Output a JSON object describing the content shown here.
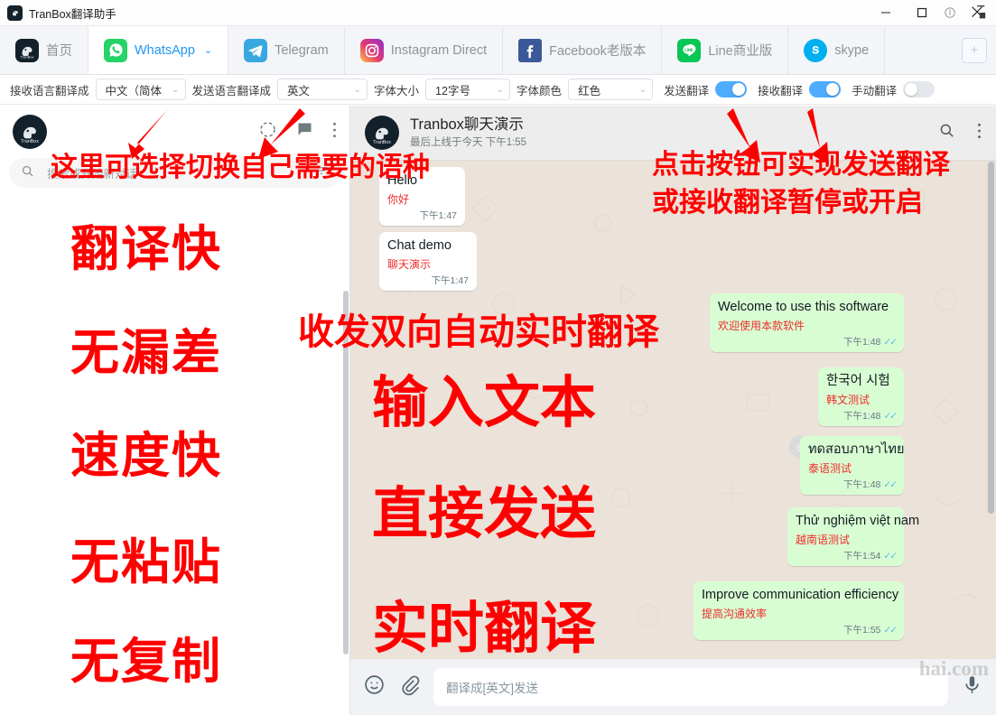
{
  "window": {
    "title": "TranBox翻译助手",
    "logo_icon": "tranbox-logo-icon",
    "minimize": "–",
    "maximize": "□",
    "info_icon": "info-icon",
    "close_icon": "close-icon"
  },
  "tabs": [
    {
      "label": "首页",
      "icon": "tranbox-home-icon",
      "active": false,
      "caret": ""
    },
    {
      "label": "WhatsApp",
      "icon": "whatsapp-icon",
      "active": true,
      "caret": "⌄"
    },
    {
      "label": "Telegram",
      "icon": "telegram-icon",
      "active": false,
      "caret": ""
    },
    {
      "label": "Instagram Direct",
      "icon": "instagram-icon",
      "active": false,
      "caret": ""
    },
    {
      "label": "Facebook老版本",
      "icon": "facebook-icon",
      "active": false,
      "caret": ""
    },
    {
      "label": "Line商业版",
      "icon": "line-icon",
      "active": false,
      "caret": ""
    },
    {
      "label": "skype",
      "icon": "skype-icon",
      "active": false,
      "caret": ""
    }
  ],
  "tab_add_label": "+",
  "toolbar": {
    "recv_lang_label": "接收语言翻译成",
    "recv_lang_value": "中文（简体",
    "send_lang_label": "发送语言翻译成",
    "send_lang_value": "英文",
    "font_size_label": "字体大小",
    "font_size_value": "12字号",
    "font_color_label": "字体颜色",
    "font_color_value": "红色",
    "send_translate_label": "发送翻译",
    "send_translate_on": true,
    "recv_translate_label": "接收翻译",
    "recv_translate_on": true,
    "manual_translate_label": "手动翻译",
    "manual_translate_on": false,
    "caret_icon": "chevron-down-icon"
  },
  "left_pane": {
    "avatar_name": "TranBox",
    "status_icon": "status-circle-icon",
    "new_chat_icon": "new-chat-icon",
    "menu_icon": "more-vertical-icon",
    "search_placeholder": "搜索或开始新对话",
    "search_icon": "search-icon",
    "filter_icon": "filter-icon"
  },
  "chat": {
    "contact_name": "Tranbox聊天演示",
    "contact_status": "最后上线于今天 下午1:55",
    "search_icon": "search-icon",
    "menu_icon": "more-vertical-icon",
    "messages": [
      {
        "text": "Hello",
        "translation": "你好",
        "time": "下午1:47",
        "side": "in",
        "ticks": false
      },
      {
        "text": "Chat demo",
        "translation": "聊天演示",
        "time": "下午1:47",
        "side": "in",
        "ticks": false
      },
      {
        "text": "Welcome to use this software",
        "translation": "欢迎使用本款软件",
        "time": "下午1:48",
        "side": "out",
        "ticks": true
      },
      {
        "text": "한국어 시험",
        "translation": "韩文测试",
        "time": "下午1:48",
        "side": "out",
        "ticks": true
      },
      {
        "text": "ทดสอบภาษาไทย",
        "translation": "泰语测试",
        "time": "下午1:48",
        "side": "out",
        "ticks": true
      },
      {
        "text": "Thử nghiệm việt nam",
        "translation": "越南语测试",
        "time": "下午1:54",
        "side": "out",
        "ticks": true
      },
      {
        "text": "Improve communication efficiency",
        "translation": "提高沟通效率",
        "time": "下午1:55",
        "side": "out",
        "ticks": true
      }
    ],
    "tick_glyph": "✓✓"
  },
  "composer": {
    "emoji_icon": "emoji-icon",
    "attach_icon": "paperclip-icon",
    "placeholder": "翻译成[英文]发送",
    "mic_icon": "microphone-icon"
  },
  "annotations": [
    {
      "id": "lang-switch-note",
      "text": "这里可选择切换自己需要的语种"
    },
    {
      "id": "toggle-note-line1",
      "text": "点击按钮可实现发送翻译"
    },
    {
      "id": "toggle-note-line2",
      "text": "或接收翻译暂停或开启"
    },
    {
      "id": "feature-1",
      "text": "翻译快"
    },
    {
      "id": "feature-2",
      "text": "无漏差"
    },
    {
      "id": "feature-3",
      "text": "速度快"
    },
    {
      "id": "feature-4",
      "text": "无粘贴"
    },
    {
      "id": "feature-5",
      "text": "无复制"
    },
    {
      "id": "center-note",
      "text": "收发双向自动实时翻译"
    },
    {
      "id": "center-1",
      "text": "输入文本"
    },
    {
      "id": "center-2",
      "text": "直接发送"
    },
    {
      "id": "center-3",
      "text": "实时翻译"
    }
  ],
  "watermark": "hai.com",
  "colors": {
    "accent": "#2196f3",
    "toggle_on": "#4facfe",
    "annotation_red": "#ff0000",
    "bubble_out": "#d9fdd3",
    "bubble_in": "#ffffff",
    "translation_red": "#f02d2d"
  }
}
